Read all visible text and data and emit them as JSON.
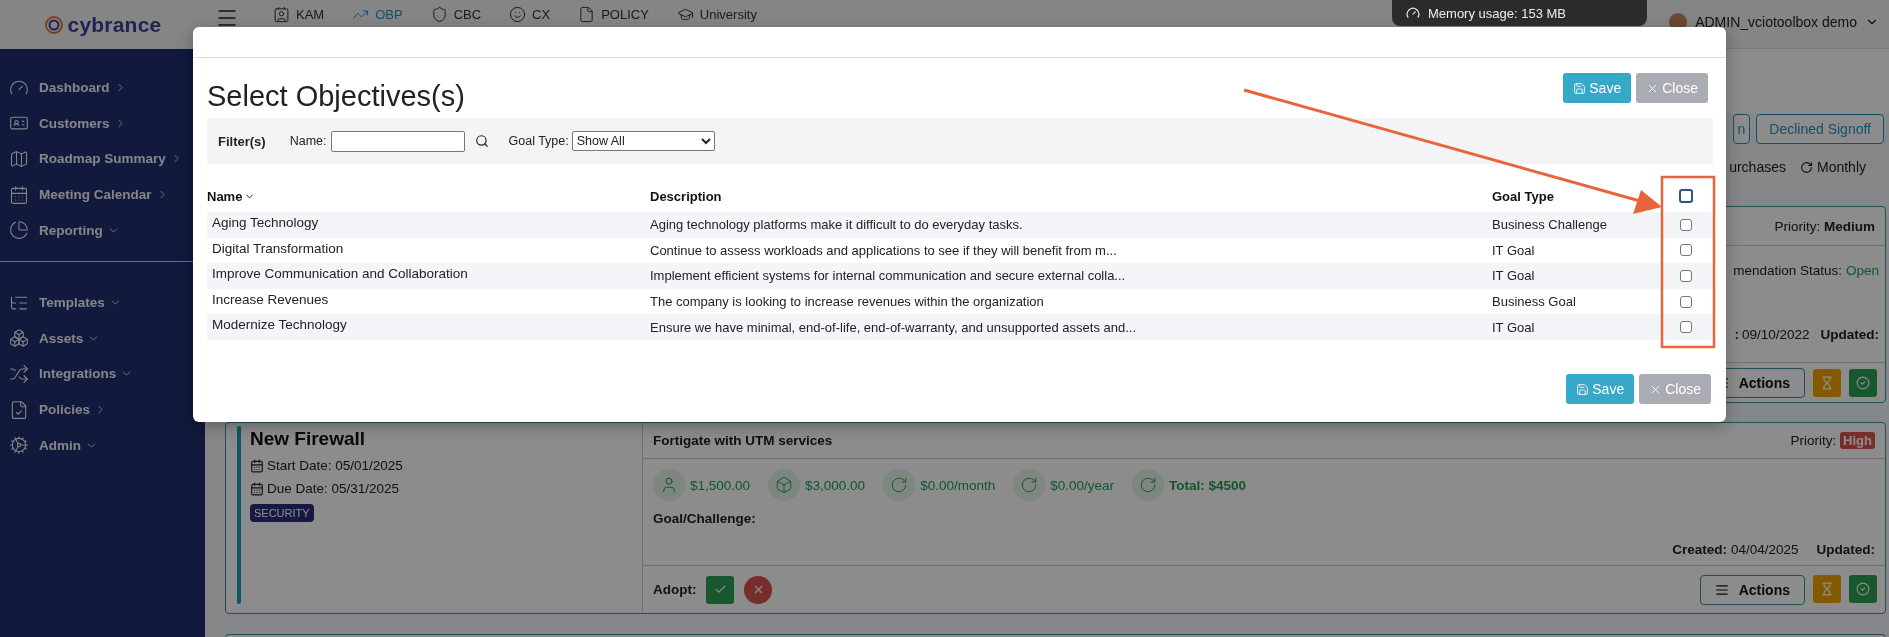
{
  "sidebar": {
    "logo": "cybrance",
    "groups": [
      [
        {
          "label": "Dashboard",
          "kind": "link"
        },
        {
          "label": "Customers",
          "kind": "link"
        },
        {
          "label": "Roadmap Summary",
          "kind": "link"
        },
        {
          "label": "Meeting Calendar",
          "kind": "link"
        },
        {
          "label": "Reporting",
          "kind": "menu"
        }
      ],
      [
        {
          "label": "Templates",
          "kind": "menu"
        },
        {
          "label": "Assets",
          "kind": "menu"
        },
        {
          "label": "Integrations",
          "kind": "menu"
        },
        {
          "label": "Policies",
          "kind": "link"
        },
        {
          "label": "Admin",
          "kind": "menu"
        }
      ]
    ]
  },
  "header": {
    "nav": [
      {
        "label": "KAM",
        "selected": false
      },
      {
        "label": "OBP",
        "selected": true
      },
      {
        "label": "CBC",
        "selected": false
      },
      {
        "label": "CX",
        "selected": false
      },
      {
        "label": "POLICY",
        "selected": false
      },
      {
        "label": "University",
        "selected": false
      }
    ],
    "user": "ADMIN_vciotoolbox demo"
  },
  "memory_tooltip": "Memory usage: 153 MB",
  "status_buttons": [
    "n",
    "Declined Signoff"
  ],
  "view_options": [
    {
      "label": "urchases",
      "kind": "plain"
    },
    {
      "label": "Monthly",
      "kind": "recurring"
    }
  ],
  "upper_card": {
    "priority_label": "Priority:",
    "priority": {
      "text": "Medium",
      "kind": "text"
    },
    "status_label": "mendation Status:",
    "status": "Open",
    "created_label": ":",
    "created": "09/10/2022",
    "updated_label": "Updated:",
    "actions": "Actions"
  },
  "lower_card": {
    "title": "New Firewall",
    "start_date": "Start Date: 05/01/2025",
    "due_date": "Due Date: 05/31/2025",
    "tag": "SECURITY",
    "summary": "Fortigate with UTM services",
    "priority_label": "Priority:",
    "priority": {
      "text": "High",
      "kind": "badge"
    },
    "costs": [
      {
        "kind": "person",
        "text": "$1,500.00"
      },
      {
        "kind": "box",
        "text": "$3,000.00"
      },
      {
        "kind": "recurring",
        "text": "$0.00/month"
      },
      {
        "kind": "recurring",
        "text": "$0.00/year"
      },
      {
        "kind": "total",
        "text": "Total: $4500"
      }
    ],
    "goal_label": "Goal/Challenge:",
    "created_label": "Created:",
    "created": "04/04/2025",
    "updated_label": "Updated:",
    "adopt_label": "Adopt:",
    "actions": "Actions"
  },
  "modal": {
    "title": "Select Objectives(s)",
    "top_buttons": [
      {
        "kind": "save",
        "label": "Save"
      },
      {
        "kind": "close",
        "label": "Close"
      }
    ],
    "filter": {
      "label": "Filter(s)",
      "name_label": "Name:",
      "goal_type_label": "Goal Type:",
      "goal_type_value": "Show All"
    },
    "table": {
      "columns": [
        {
          "label": "Name",
          "sorted": true
        },
        {
          "label": "Description",
          "sorted": false
        },
        {
          "label": "Goal Type",
          "sorted": false
        }
      ],
      "select_all": {
        "checked": false
      },
      "rows": [
        {
          "name": "Aging Technology",
          "description": "Aging technology platforms make it difficult to do everyday tasks.",
          "goal_type": "Business Challenge",
          "checked": false
        },
        {
          "name": "Digital Transformation",
          "description": "Continue to assess workloads and applications to see if they will benefit from m...",
          "goal_type": "IT Goal",
          "checked": false
        },
        {
          "name": "Improve Communication and Collaboration",
          "description": "Implement efficient systems for internal communication and secure external colla...",
          "goal_type": "IT Goal",
          "checked": false
        },
        {
          "name": "Increase Revenues",
          "description": "The company is looking to increase revenues within the organization",
          "goal_type": "Business Goal",
          "checked": false
        },
        {
          "name": "Modernize Technology",
          "description": "Ensure we have minimal, end-of-life, end-of-warranty, and unsupported assets and...",
          "goal_type": "IT Goal",
          "checked": false
        }
      ]
    },
    "bottom_buttons": [
      {
        "kind": "save",
        "label": "Save"
      },
      {
        "kind": "close",
        "label": "Close"
      }
    ]
  },
  "annotation": {
    "kind": "arrow-and-box"
  }
}
